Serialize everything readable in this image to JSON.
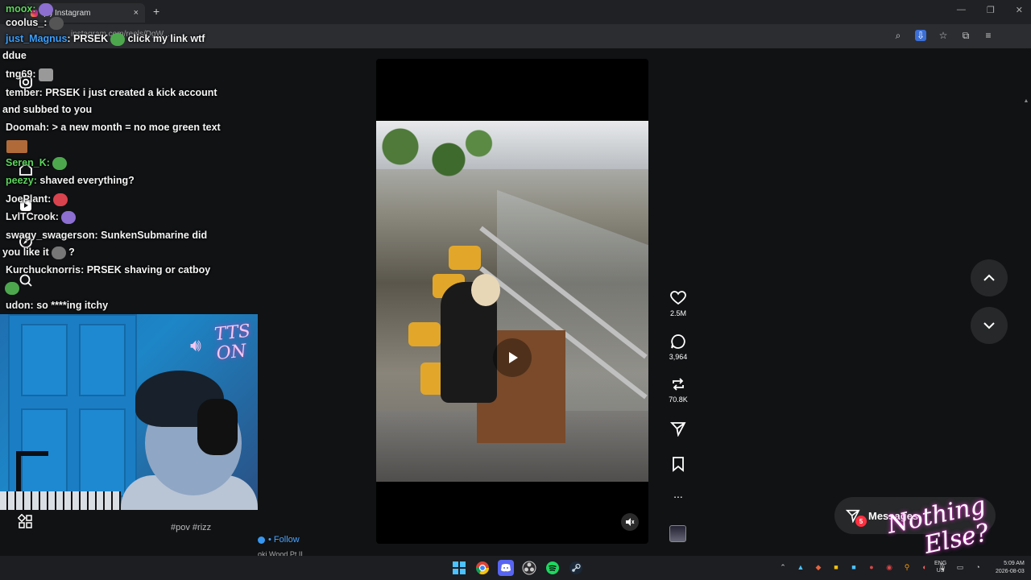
{
  "browser": {
    "tab_title": "(5) Instagram",
    "tab_close": "×",
    "new_tab": "+",
    "url": "instagram.com/reels/DgW...",
    "window_controls": [
      "—",
      "❐",
      "✕"
    ]
  },
  "chat": [
    {
      "user": "moox:",
      "text": "",
      "color": "#5bd65b"
    },
    {
      "user": "coolus_:",
      "text": "",
      "color": "#f0f0f0"
    },
    {
      "user": "just_Magnus",
      "text": ": PRSEK",
      "text2": "click my link wtf",
      "color": "#3aa0ff"
    },
    {
      "user": "",
      "text": "ddue",
      "color": "#f0f0f0"
    },
    {
      "user": "tng69:",
      "text": "",
      "color": "#f0f0f0"
    },
    {
      "user": "tember:",
      "text": " PRSEK i just created a kick account",
      "color": "#f0f0f0"
    },
    {
      "user": "",
      "text": "and subbed to you",
      "color": "#f0f0f0"
    },
    {
      "user": "Doomah:",
      "text": " > a new month = no moe green text",
      "color": "#f0f0f0"
    },
    {
      "user": "Seren_K:",
      "text": "",
      "color": "#5bd65b"
    },
    {
      "user": "peezy:",
      "text": " shaved everything?",
      "color": "#5bd65b"
    },
    {
      "user": "JoePlant:",
      "text": "",
      "color": "#f0f0f0"
    },
    {
      "user": "LvlTCrook:",
      "text": "",
      "color": "#f0f0f0"
    },
    {
      "user": "swagy_swagerson:",
      "text": " SunkenSubmarine did",
      "color": "#f0f0f0"
    },
    {
      "user": "",
      "text": "you like it",
      "text2": "?",
      "color": "#f0f0f0"
    },
    {
      "user": "Kurchucknorris:",
      "text": " PRSEK shaving or catboy",
      "color": "#f0f0f0"
    },
    {
      "user": "udon:",
      "text": " so ****ing itchy",
      "color": "#f0f0f0"
    }
  ],
  "overlay": {
    "tts_line1": "TTS",
    "tts_line2": "ON",
    "brand_line1": "Nothing",
    "brand_line2": "Else?"
  },
  "post": {
    "follow_label": "• Follow",
    "audio": "oki Wood Pt.II",
    "tags": "#pov #rizz"
  },
  "actions": {
    "likes": "2.5M",
    "comments": "3,964",
    "reposts": "70.8K",
    "more": "..."
  },
  "messages": {
    "label": "Messages",
    "badge": "5"
  },
  "taskbar": {
    "lang_line1": "ENG",
    "lang_line2": "US",
    "time": "5:09 AM",
    "date": "2026-08-03"
  },
  "colors": {
    "accent_blue": "#3797f0",
    "badge_red": "#ff3040",
    "page_bg": "#101214"
  }
}
